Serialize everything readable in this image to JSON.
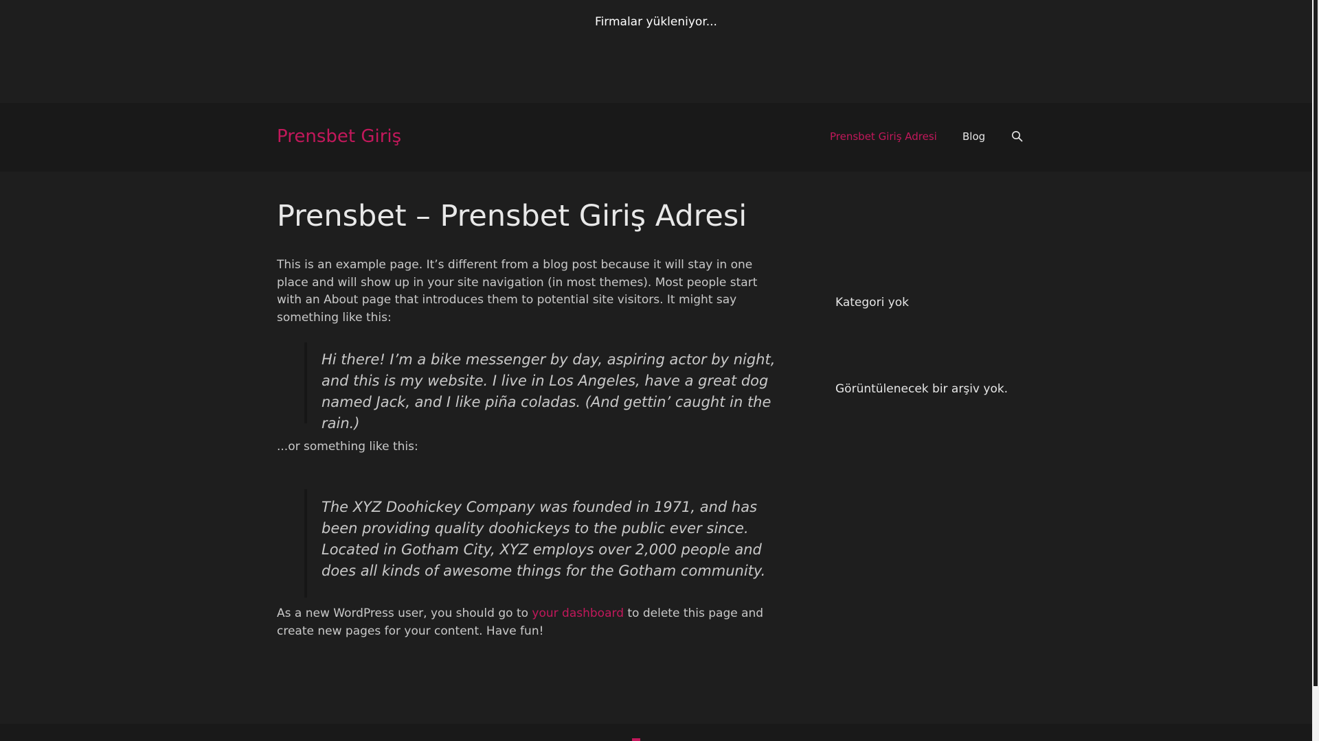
{
  "topbar": {
    "loading_text": "Firmalar yükleniyor..."
  },
  "header": {
    "site_title": "Prensbet Giriş",
    "nav": [
      {
        "label": "Prensbet Giriş Adresi",
        "active": true
      },
      {
        "label": "Blog",
        "active": false
      }
    ],
    "search_icon": "search-icon"
  },
  "main": {
    "title": "Prensbet – Prensbet Giriş Adresi",
    "intro": "This is an example page. It’s different from a blog post because it will stay in one place and will show up in your site navigation (in most themes). Most people start with an About page that introduces them to potential site visitors. It might say something like this:",
    "quote1": "Hi there! I’m a bike messenger by day, aspiring actor by night, and this is my website. I live in Los Angeles, have a great dog named Jack, and I like piña coladas. (And gettin’ caught in the rain.)",
    "or_text": "...or something like this:",
    "quote2": "The XYZ Doohickey Company was founded in 1971, and has been providing quality doohickeys to the public ever since. Located in Gotham City, XYZ employs over 2,000 people and does all kinds of awesome things for the Gotham community.",
    "outro_before": "As a new WordPress user, you should go to ",
    "outro_link": "your dashboard",
    "outro_after": " to delete this page and create new pages for your content. Have fun!"
  },
  "sidebar": {
    "categories_empty": "Kategori yok",
    "archives_empty": "Görüntülenecek bir arşiv yok."
  },
  "colors": {
    "accent": "#c2185b",
    "background": "#1e1e1e",
    "header_bg": "#191919"
  }
}
